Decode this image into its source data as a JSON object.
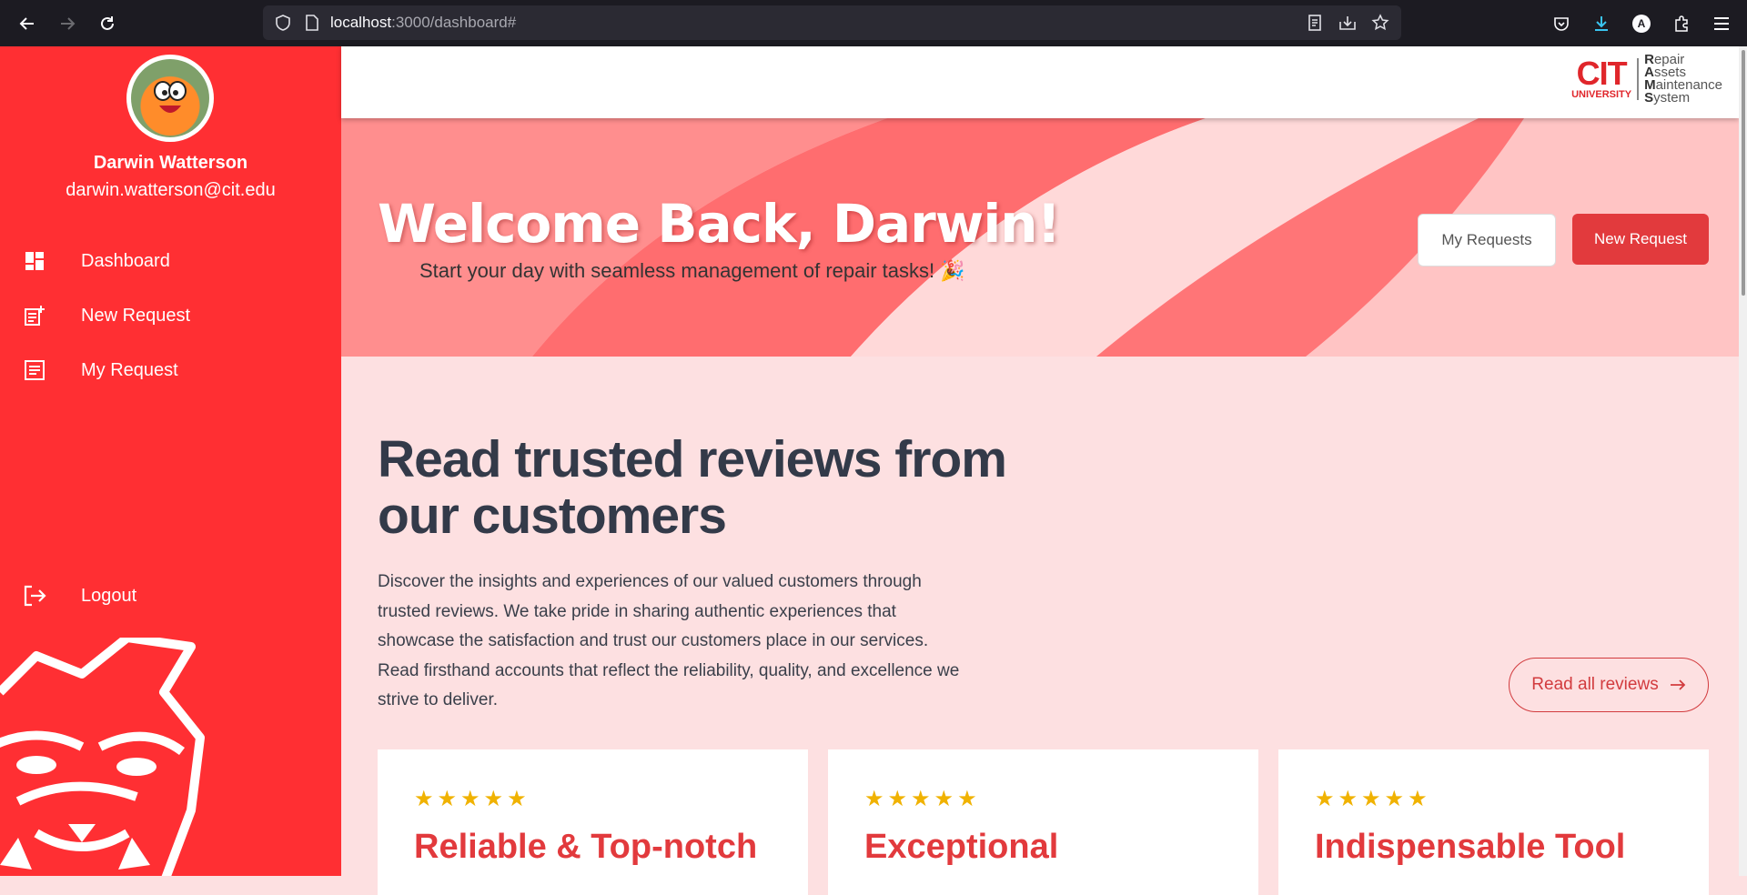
{
  "browser": {
    "url_host": "localhost",
    "url_rest": ":3000/dashboard#"
  },
  "sidebar": {
    "user_name": "Darwin Watterson",
    "user_email": "darwin.watterson@cit.edu",
    "items": [
      {
        "label": "Dashboard",
        "icon": "dashboard-icon"
      },
      {
        "label": "New Request",
        "icon": "new-request-icon"
      },
      {
        "label": "My Request",
        "icon": "my-request-icon"
      }
    ],
    "logout_label": "Logout"
  },
  "header": {
    "logo_big": "CIT",
    "logo_small": "UNIVERSITY",
    "logo_lines": [
      {
        "first": "R",
        "rest": "epair"
      },
      {
        "first": "A",
        "rest": "ssets"
      },
      {
        "first": "M",
        "rest": "aintenance"
      },
      {
        "first": "S",
        "rest": "ystem"
      }
    ]
  },
  "hero": {
    "title": "Welcome Back, Darwin!",
    "subtitle": "Start your day with seamless management of repair tasks! 🎉",
    "my_requests_label": "My Requests",
    "new_request_label": "New Request"
  },
  "reviews": {
    "title": "Read trusted reviews from our customers",
    "description": "Discover the insights and experiences of our valued customers through trusted reviews. We take pride in sharing authentic experiences that showcase the satisfaction and trust our customers place in our services. Read firsthand accounts that reflect the reliability, quality, and excellence we strive to deliver.",
    "read_all_label": "Read all reviews",
    "cards": [
      {
        "stars": "★★★★★",
        "title": "Reliable & Top-notch"
      },
      {
        "stars": "★★★★★",
        "title": "Exceptional"
      },
      {
        "stars": "★★★★★",
        "title": "Indispensable Tool"
      }
    ]
  },
  "colors": {
    "sidebar": "#ff2f33",
    "accent": "#e23a3d",
    "page_bg": "#fde0e1",
    "star": "#f0b200"
  }
}
